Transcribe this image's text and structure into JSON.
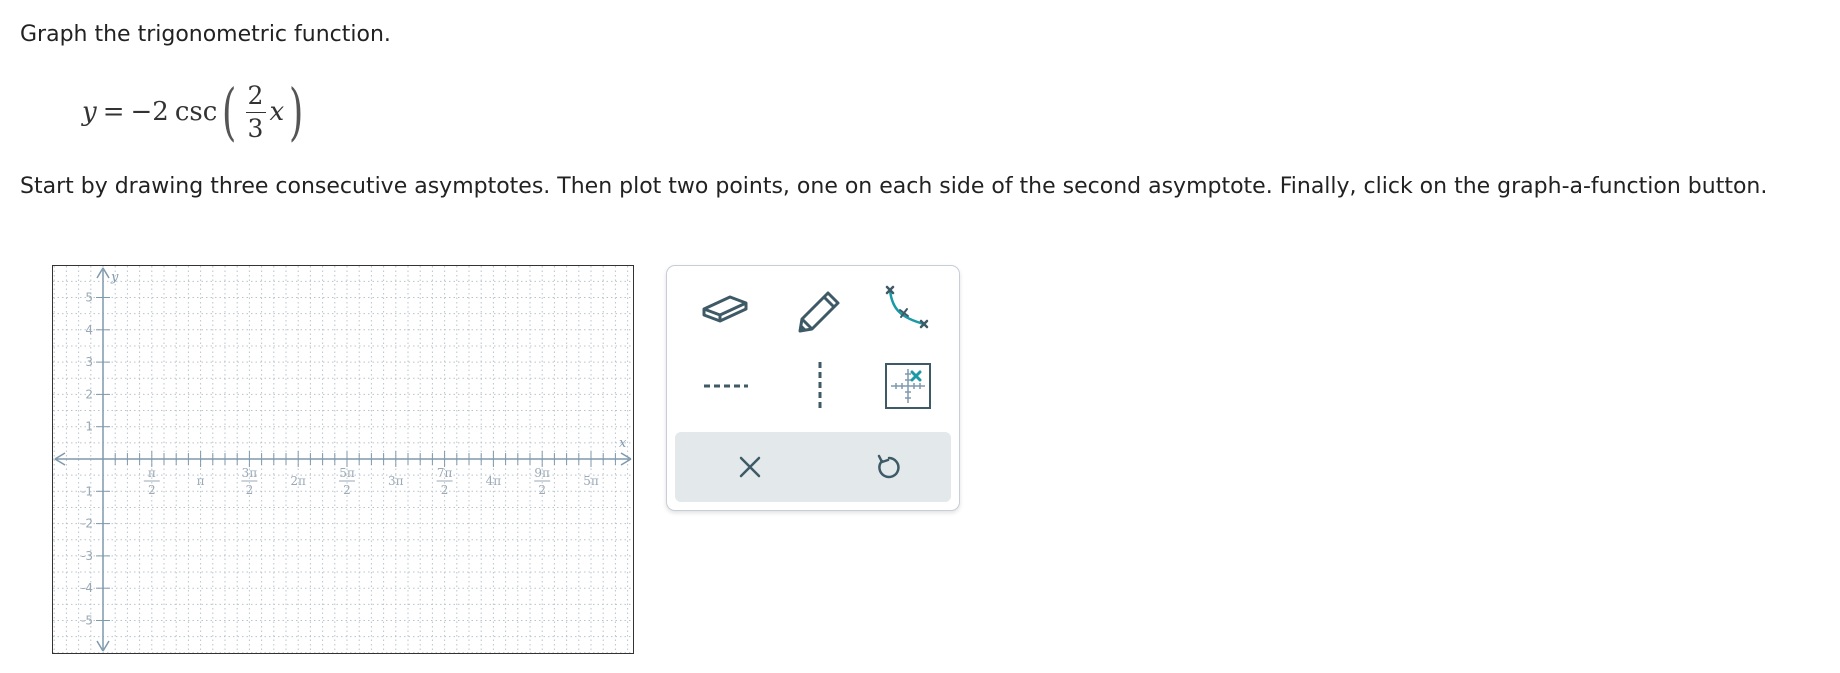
{
  "prompt": "Graph the trigonometric function.",
  "equation": {
    "lhs": "y",
    "equals": "=",
    "coefficient": "−2",
    "func": "csc",
    "numerator": "2",
    "denominator": "3",
    "variable": "x"
  },
  "instructions": "Start by drawing three consecutive asymptotes. Then plot two points, one on each side of the second asymptote. Finally, click on the graph-a-function button.",
  "graph": {
    "x_axis_label": "x",
    "y_axis_label": "y",
    "y_ticks": [
      "5",
      "4",
      "3",
      "2",
      "1",
      "-1",
      "-2",
      "-3",
      "-4",
      "-5"
    ],
    "x_ticks": [
      {
        "label": "π/2",
        "num": "π",
        "den": "2"
      },
      {
        "label": "π"
      },
      {
        "label": "3π/2",
        "num": "3π",
        "den": "2"
      },
      {
        "label": "2π"
      },
      {
        "label": "5π/2",
        "num": "5π",
        "den": "2"
      },
      {
        "label": "3π"
      },
      {
        "label": "7π/2",
        "num": "7π",
        "den": "2"
      },
      {
        "label": "4π"
      },
      {
        "label": "9π/2",
        "num": "9π",
        "den": "2"
      },
      {
        "label": "5π"
      }
    ]
  },
  "tools": {
    "eraser": "eraser-icon",
    "pencil": "pencil-icon",
    "graph_function": "graph-function-icon",
    "horizontal_asymptote": "horizontal-dashed-line-icon",
    "vertical_asymptote": "vertical-dashed-line-icon",
    "grid_point": "grid-point-icon",
    "clear": "close-icon",
    "undo": "undo-icon"
  },
  "colors": {
    "tool_icon": "#3d5a66",
    "accent": "#1a9aa6",
    "axis": "#7f99ad",
    "grid": "#b8c4cc",
    "action_bar": "#e3e8eb"
  }
}
